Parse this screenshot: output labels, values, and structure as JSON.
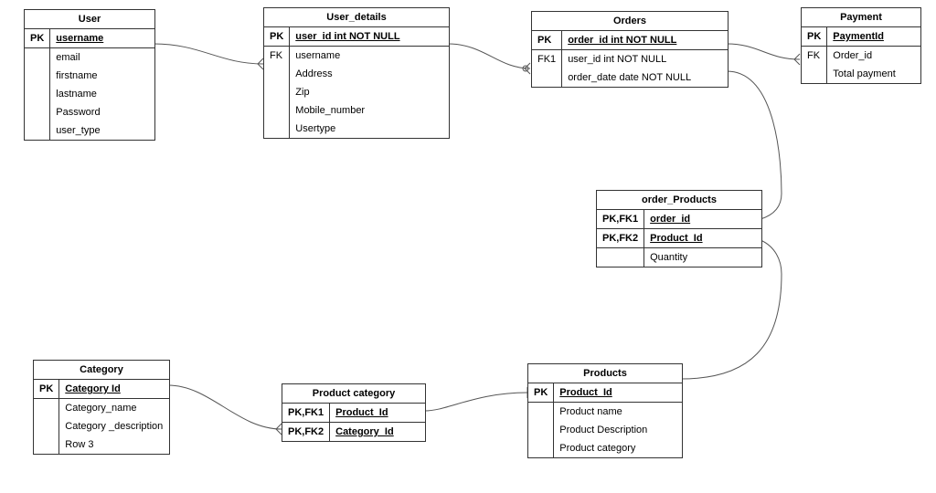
{
  "entities": {
    "user": {
      "title": "User",
      "rows": [
        {
          "key": "PK",
          "field": "username",
          "pk": true,
          "sep": false
        },
        {
          "key": "",
          "field": "email",
          "sep": true
        },
        {
          "key": "",
          "field": "firstname"
        },
        {
          "key": "",
          "field": "lastname"
        },
        {
          "key": "",
          "field": "Password"
        },
        {
          "key": "",
          "field": "user_type"
        }
      ]
    },
    "user_details": {
      "title": "User_details",
      "rows": [
        {
          "key": "PK",
          "field": "user_id int NOT NULL",
          "pk": true
        },
        {
          "key": "FK",
          "field": "username",
          "sep": true
        },
        {
          "key": "",
          "field": "Address"
        },
        {
          "key": "",
          "field": "Zip"
        },
        {
          "key": "",
          "field": "Mobile_number"
        },
        {
          "key": "",
          "field": "Usertype"
        }
      ]
    },
    "orders": {
      "title": "Orders",
      "rows": [
        {
          "key": "PK",
          "field": "order_id int NOT NULL",
          "pk": true
        },
        {
          "key": "FK1",
          "field": "user_id int NOT NULL",
          "sep": true
        },
        {
          "key": "",
          "field": "order_date date NOT NULL"
        }
      ]
    },
    "payment": {
      "title": "Payment",
      "rows": [
        {
          "key": "PK",
          "field": "PaymentId",
          "pk": true
        },
        {
          "key": "FK",
          "field": "Order_id",
          "sep": true
        },
        {
          "key": "",
          "field": "Total payment"
        }
      ]
    },
    "order_products": {
      "title": "order_Products",
      "rows": [
        {
          "key": "PK,FK1",
          "field": "order_id",
          "pk": true
        },
        {
          "key": "PK,FK2",
          "field": "Product_Id",
          "pk": true,
          "sep": true
        },
        {
          "key": "",
          "field": "Quantity",
          "sep": true
        }
      ]
    },
    "category": {
      "title": "Category",
      "rows": [
        {
          "key": "PK",
          "field": "Category Id",
          "pk": true
        },
        {
          "key": "",
          "field": "Category_name",
          "sep": true
        },
        {
          "key": "",
          "field": "Category _description"
        },
        {
          "key": "",
          "field": "Row 3"
        }
      ]
    },
    "product_category": {
      "title": "Product category",
      "rows": [
        {
          "key": "PK,FK1",
          "field": "Product_Id",
          "pk": true
        },
        {
          "key": "PK,FK2",
          "field": "Category_Id",
          "pk": true,
          "sep": true
        }
      ]
    },
    "products": {
      "title": "Products",
      "rows": [
        {
          "key": "PK",
          "field": "Product_Id",
          "pk": true
        },
        {
          "key": "",
          "field": "Product name",
          "sep": true
        },
        {
          "key": "",
          "field": "Product Description"
        },
        {
          "key": "",
          "field": "Product category"
        }
      ]
    }
  },
  "relationships": [
    {
      "from": "user.username (PK)",
      "to": "user_details.username (FK)",
      "type": "one-to-many"
    },
    {
      "from": "user_details.user_id (PK)",
      "to": "orders.user_id (FK1)",
      "type": "one-to-many"
    },
    {
      "from": "orders.order_id (PK)",
      "to": "payment.Order_id (FK)",
      "type": "one-to-many"
    },
    {
      "from": "orders.order_id (PK)",
      "to": "order_products.order_id (PK,FK1)",
      "type": "one-to-many"
    },
    {
      "from": "products.Product_Id (PK)",
      "to": "order_products.Product_Id (PK,FK2)",
      "type": "one-to-many"
    },
    {
      "from": "products.Product_Id (PK)",
      "to": "product_category.Product_Id (PK,FK1)",
      "type": "one-to-many"
    },
    {
      "from": "category.Category Id (PK)",
      "to": "product_category.Category_Id (PK,FK2)",
      "type": "one-to-many"
    }
  ]
}
